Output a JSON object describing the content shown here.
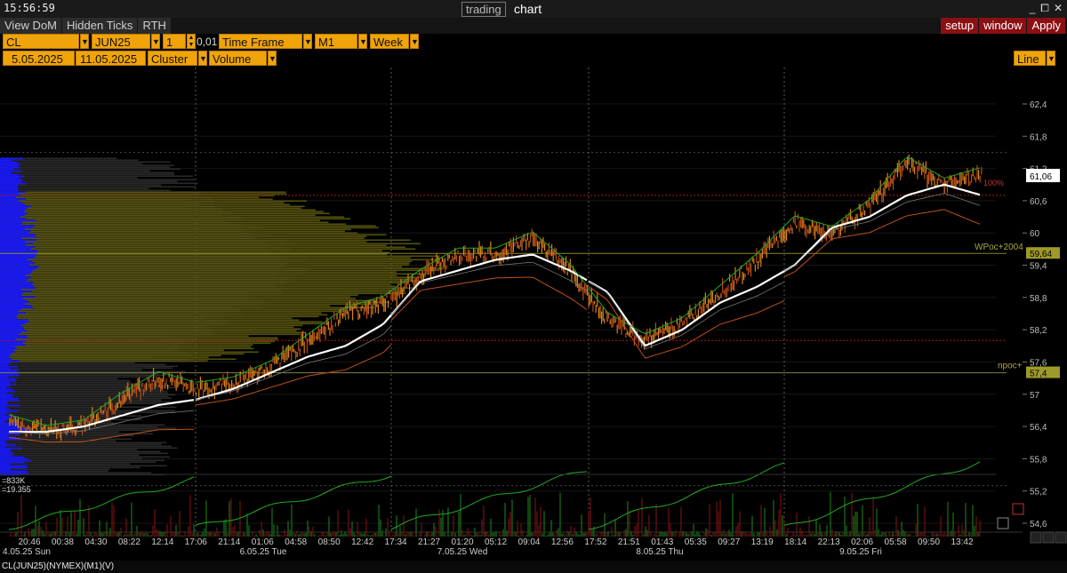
{
  "window": {
    "clock": "15:56:59",
    "title_boxed": "trading",
    "title_plain": "chart"
  },
  "menubar": {
    "left": [
      "View DoM",
      "Hidden Ticks",
      "RTH"
    ],
    "right": [
      "setup",
      "window",
      "Apply"
    ]
  },
  "toolbar": {
    "symbol": "CL",
    "contract": "JUN25",
    "multiplier": "1",
    "tick": "0,01",
    "timeframe_label": "Time Frame",
    "timeframe": "M1",
    "period": "Week",
    "date_from": "5.05.2025",
    "date_to": "11.05.2025",
    "chart_style": "Cluster",
    "cluster_type": "Volume",
    "line_mode": "Line"
  },
  "colors": {
    "accent": "#f0a40a",
    "menu_red": "#8c0f12",
    "profile_blue": "#1a1aff",
    "profile_olive": "#5c5a10",
    "price_orange": "#d9801c",
    "vwap_white": "#ffffff",
    "ma_green": "#22aa22",
    "level_red": "#b01515"
  },
  "chart_data": {
    "type": "line",
    "price_axis": {
      "ticks": [
        "62,4",
        "61,8",
        "61,2",
        "60,6",
        "60",
        "59,4",
        "58,8",
        "58,2",
        "57,6",
        "57",
        "56,4",
        "55,8",
        "55,2",
        "54,6"
      ],
      "ylim": [
        54.4,
        62.9
      ]
    },
    "current_price": "61,06",
    "levels": [
      {
        "label": "100%",
        "price": 60.7
      },
      {
        "label": "WPoc+2004",
        "value": "59,64",
        "price": 59.62
      },
      {
        "label": "npoc+",
        "value": "57,4",
        "price": 57.4
      }
    ],
    "time_labels": [
      "20:46",
      "00:38",
      "04:30",
      "08:22",
      "12:14",
      "17:06",
      "21:14",
      "01:06",
      "04:58",
      "08:50",
      "12:42",
      "17:34",
      "21:27",
      "01:20",
      "05:12",
      "09:04",
      "12:56",
      "17:52",
      "21:51",
      "01:43",
      "05:35",
      "09:27",
      "13:19",
      "18:14",
      "22:13",
      "02:06",
      "05:58",
      "09:50",
      "13:42"
    ],
    "date_labels": [
      "4.05.25 Sun",
      "6.05.25 Tue",
      "7.05.25 Wed",
      "8.05.25 Thu",
      "9.05.25 Fri"
    ],
    "volume_readouts": [
      "=833K",
      "=19.355"
    ],
    "series": [
      {
        "values": [
          56.5,
          56.3,
          56.4,
          56.9,
          57.3,
          57.1,
          57.2,
          57.5,
          58.0,
          58.5,
          58.7,
          59.2,
          59.6,
          59.6,
          59.9,
          59.3,
          58.4,
          58.0,
          58.3,
          58.9,
          59.5,
          60.2,
          60.0,
          60.5,
          61.3,
          60.9,
          61.1
        ]
      },
      {
        "values": [
          56.3,
          56.3,
          56.4,
          56.6,
          56.8,
          56.9,
          57.1,
          57.4,
          57.7,
          57.9,
          58.3,
          59.1,
          59.3,
          59.5,
          59.6,
          59.3,
          58.9,
          57.9,
          58.2,
          58.7,
          59.0,
          59.4,
          60.1,
          60.3,
          60.7,
          60.9,
          60.7
        ]
      }
    ]
  },
  "status_text": "CL(JUN25)(NYMEX)(M1)(V)"
}
